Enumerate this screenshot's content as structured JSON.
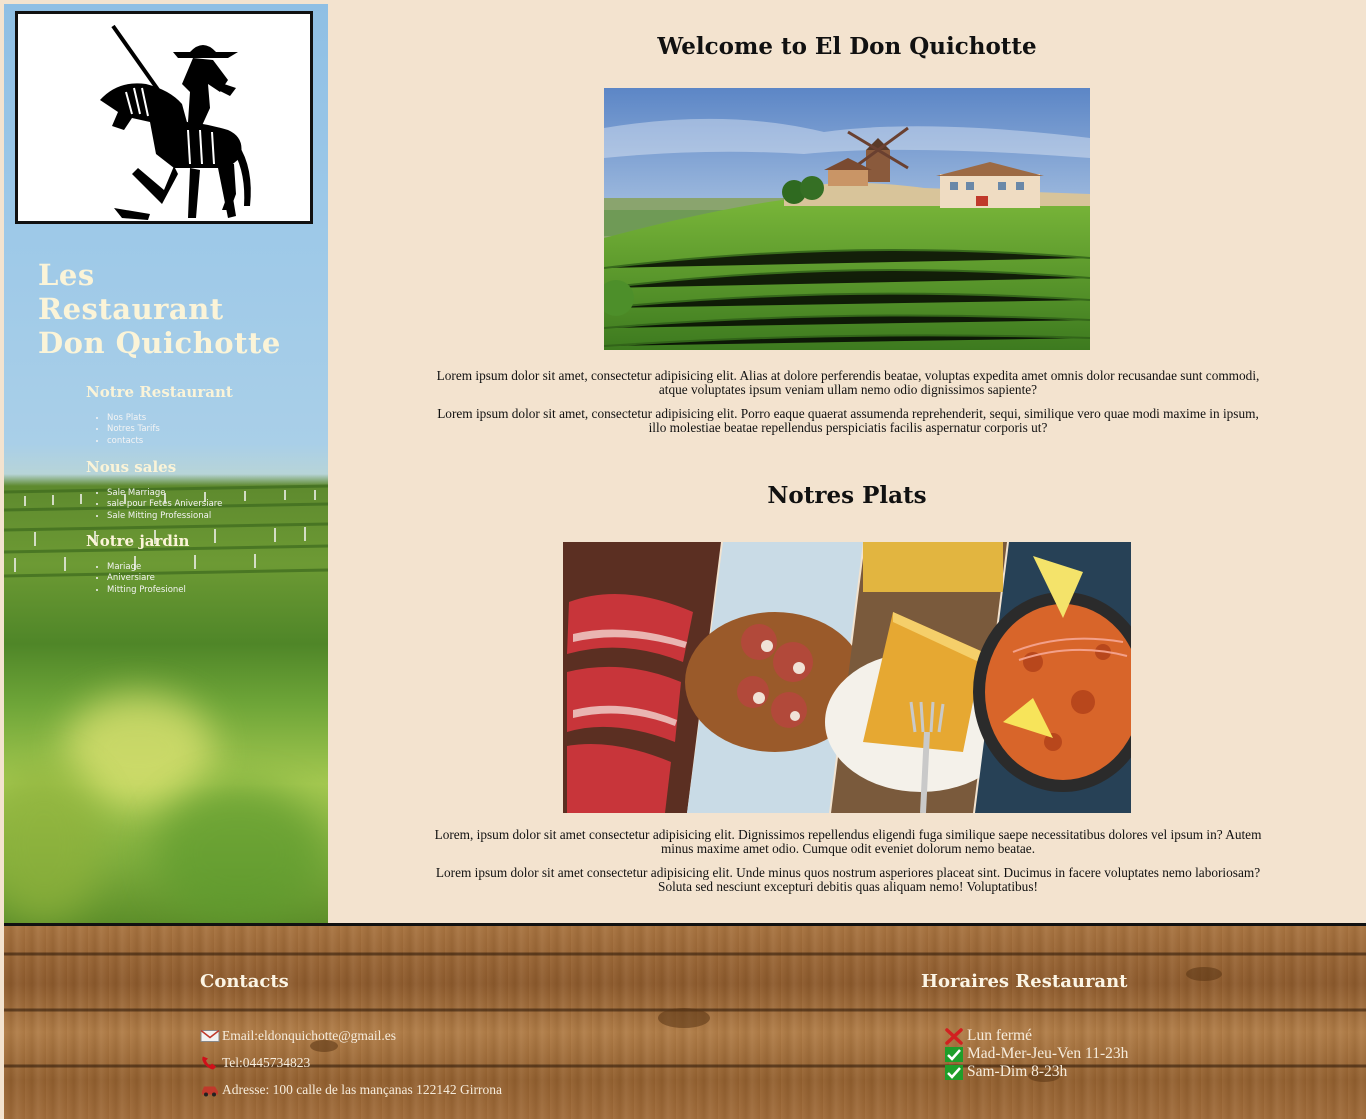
{
  "sidebar": {
    "brand_lines": [
      "Les",
      "Restaurant",
      "Don Quichotte"
    ],
    "sections": [
      {
        "heading": "Notre Restaurant",
        "items": [
          "Nos Plats",
          "Notres Tarifs",
          "contacts"
        ]
      },
      {
        "heading": "Nous sales",
        "items": [
          "Sale Marriage",
          "sale pour Fetes Aniversiare",
          "Sale Mitting Professional"
        ]
      },
      {
        "heading": "Notre jardin",
        "items": [
          "Mariage",
          "Aniversiare",
          "Mitting Profesionel"
        ]
      }
    ]
  },
  "main": {
    "welcome_title": "Welcome to El Don Quichotte",
    "welcome_paragraphs": [
      "Lorem ipsum dolor sit amet, consectetur adipisicing elit. Alias at dolore perferendis beatae, voluptas expedita amet omnis dolor recusandae sunt commodi, atque voluptates ipsum veniam ullam nemo odio dignissimos sapiente?",
      "Lorem ipsum dolor sit amet, consectetur adipisicing elit. Porro eaque quaerat assumenda reprehenderit, sequi, similique vero quae modi maxime in ipsum, illo molestiae beatae repellendus perspiciatis facilis aspernatur corporis ut?"
    ],
    "plats_title": "Notres Plats",
    "plats_paragraphs": [
      "Lorem, ipsum dolor sit amet consectetur adipisicing elit. Dignissimos repellendus eligendi fuga similique saepe necessitatibus dolores vel ipsum in? Autem minus maxime amet odio. Cumque odit eveniet dolorum nemo beatae.",
      "Lorem ipsum dolor sit amet consectetur adipisicing elit. Unde minus quos nostrum asperiores placeat sint. Ducimus in facere voluptates nemo laboriosam? Soluta sed nesciunt excepturi debitis quas aliquam nemo! Voluptatibus!"
    ]
  },
  "footer": {
    "contacts_heading": "Contacts",
    "email": "Email:eldonquichotte@gmail.es",
    "phone": "Tel:0445734823",
    "address": "Adresse: 100 calle de las mançanas 122142 Girrona",
    "hours_heading": "Horaires Restaurant",
    "hours": [
      {
        "label": "Lun fermé",
        "status": "closed"
      },
      {
        "label": "Mad-Mer-Jeu-Ven 11-23h",
        "status": "open"
      },
      {
        "label": "Sam-Dim 8-23h",
        "status": "open"
      }
    ]
  },
  "colors": {
    "page_bg": "#f3e3cf",
    "sidebar_text": "#fbf4d8",
    "closed_icon": "#d22020",
    "open_icon": "#1e9e2a"
  }
}
